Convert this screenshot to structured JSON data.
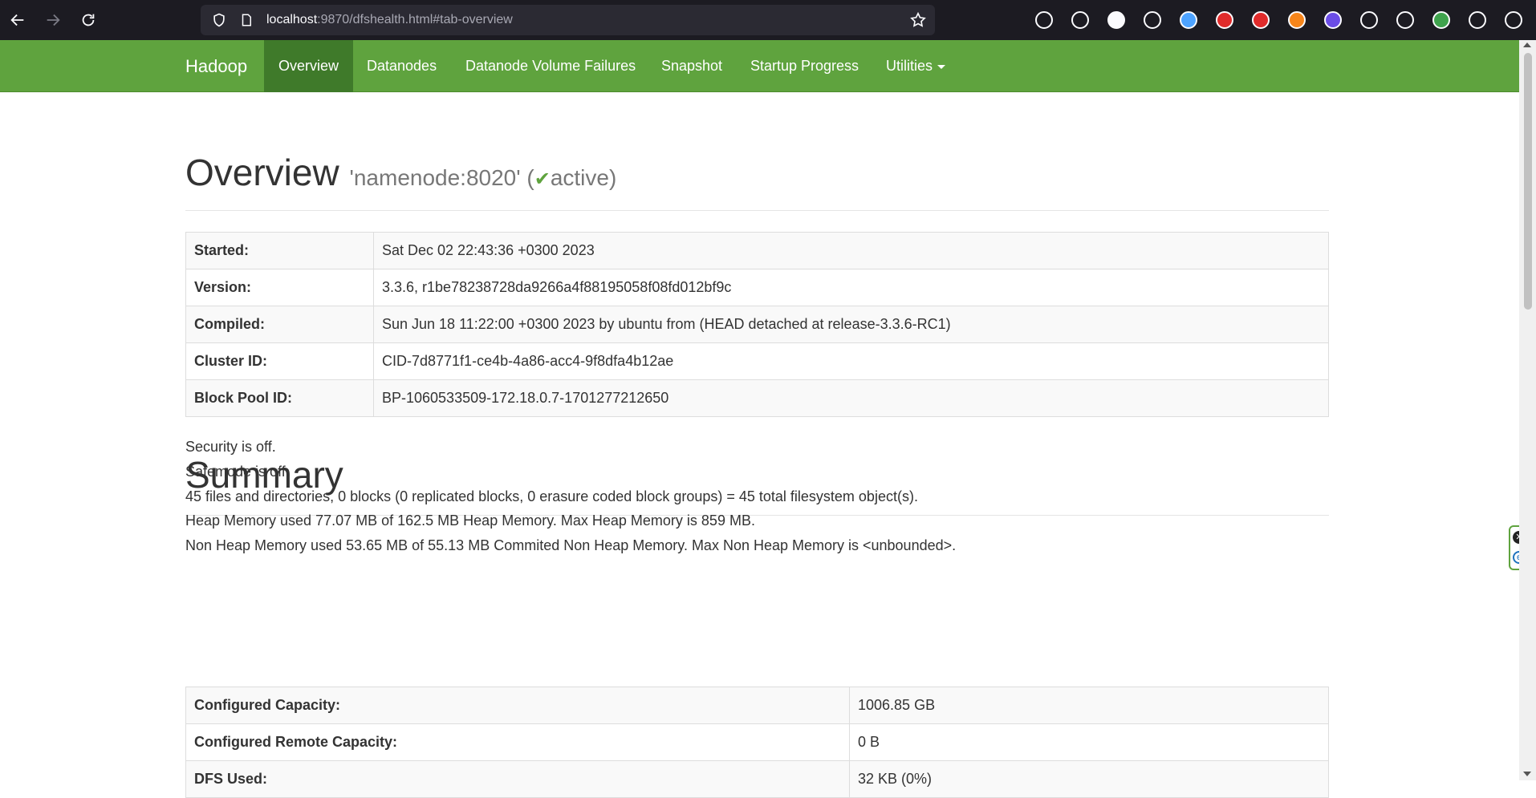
{
  "browser": {
    "url_host": "localhost",
    "url_rest": ":9870/dfshealth.html#tab-overview"
  },
  "nav": {
    "brand": "Hadoop",
    "items": [
      "Overview",
      "Datanodes",
      "Datanode Volume Failures",
      "Snapshot",
      "Startup Progress",
      "Utilities"
    ]
  },
  "overview": {
    "heading": "Overview",
    "host": "'namenode:8020'",
    "status": "active",
    "rows": [
      {
        "key": "Started:",
        "value": "Sat Dec 02 22:43:36 +0300 2023"
      },
      {
        "key": "Version:",
        "value": "3.3.6, r1be78238728da9266a4f88195058f08fd012bf9c"
      },
      {
        "key": "Compiled:",
        "value": "Sun Jun 18 11:22:00 +0300 2023 by ubuntu from (HEAD detached at release-3.3.6-RC1)"
      },
      {
        "key": "Cluster ID:",
        "value": "CID-7d8771f1-ce4b-4a86-acc4-9f8dfa4b12ae"
      },
      {
        "key": "Block Pool ID:",
        "value": "BP-1060533509-172.18.0.7-1701277212650"
      }
    ]
  },
  "summary": {
    "heading": "Summary",
    "lines": [
      "Security is off.",
      "Safemode is off.",
      "45 files and directories, 0 blocks (0 replicated blocks, 0 erasure coded block groups) = 45 total filesystem object(s).",
      "Heap Memory used 77.07 MB of 162.5 MB Heap Memory. Max Heap Memory is 859 MB.",
      "Non Heap Memory used 53.65 MB of 55.13 MB Commited Non Heap Memory. Max Non Heap Memory is <unbounded>."
    ],
    "rows": [
      {
        "key": "Configured Capacity:",
        "value": "1006.85 GB"
      },
      {
        "key": "Configured Remote Capacity:",
        "value": "0 B"
      },
      {
        "key": "DFS Used:",
        "value": "32 KB (0%)"
      }
    ]
  },
  "extensions": [
    {
      "name": "pocket-icon",
      "color": "#1c1b22"
    },
    {
      "name": "download-icon",
      "color": "#1c1b22"
    },
    {
      "name": "a-icon",
      "color": "#fbfbfe"
    },
    {
      "name": "bars-icon",
      "color": "#1c1b22"
    },
    {
      "name": "circle-icon",
      "color": "#4da3ff"
    },
    {
      "name": "abp-icon",
      "color": "#e02b2b"
    },
    {
      "name": "hand-icon",
      "color": "#e02b2b"
    },
    {
      "name": "fox-icon",
      "color": "#f6851b"
    },
    {
      "name": "ghost-icon",
      "color": "#6b4de6"
    },
    {
      "name": "shield-icon",
      "color": "#1c1b22"
    },
    {
      "name": "glasses-icon",
      "color": "#1c1b22"
    },
    {
      "name": "puzzle-color-icon",
      "color": "#3fa34d"
    },
    {
      "name": "puzzle-icon",
      "color": "#1c1b22"
    },
    {
      "name": "menu-icon",
      "color": "#1c1b22"
    }
  ]
}
